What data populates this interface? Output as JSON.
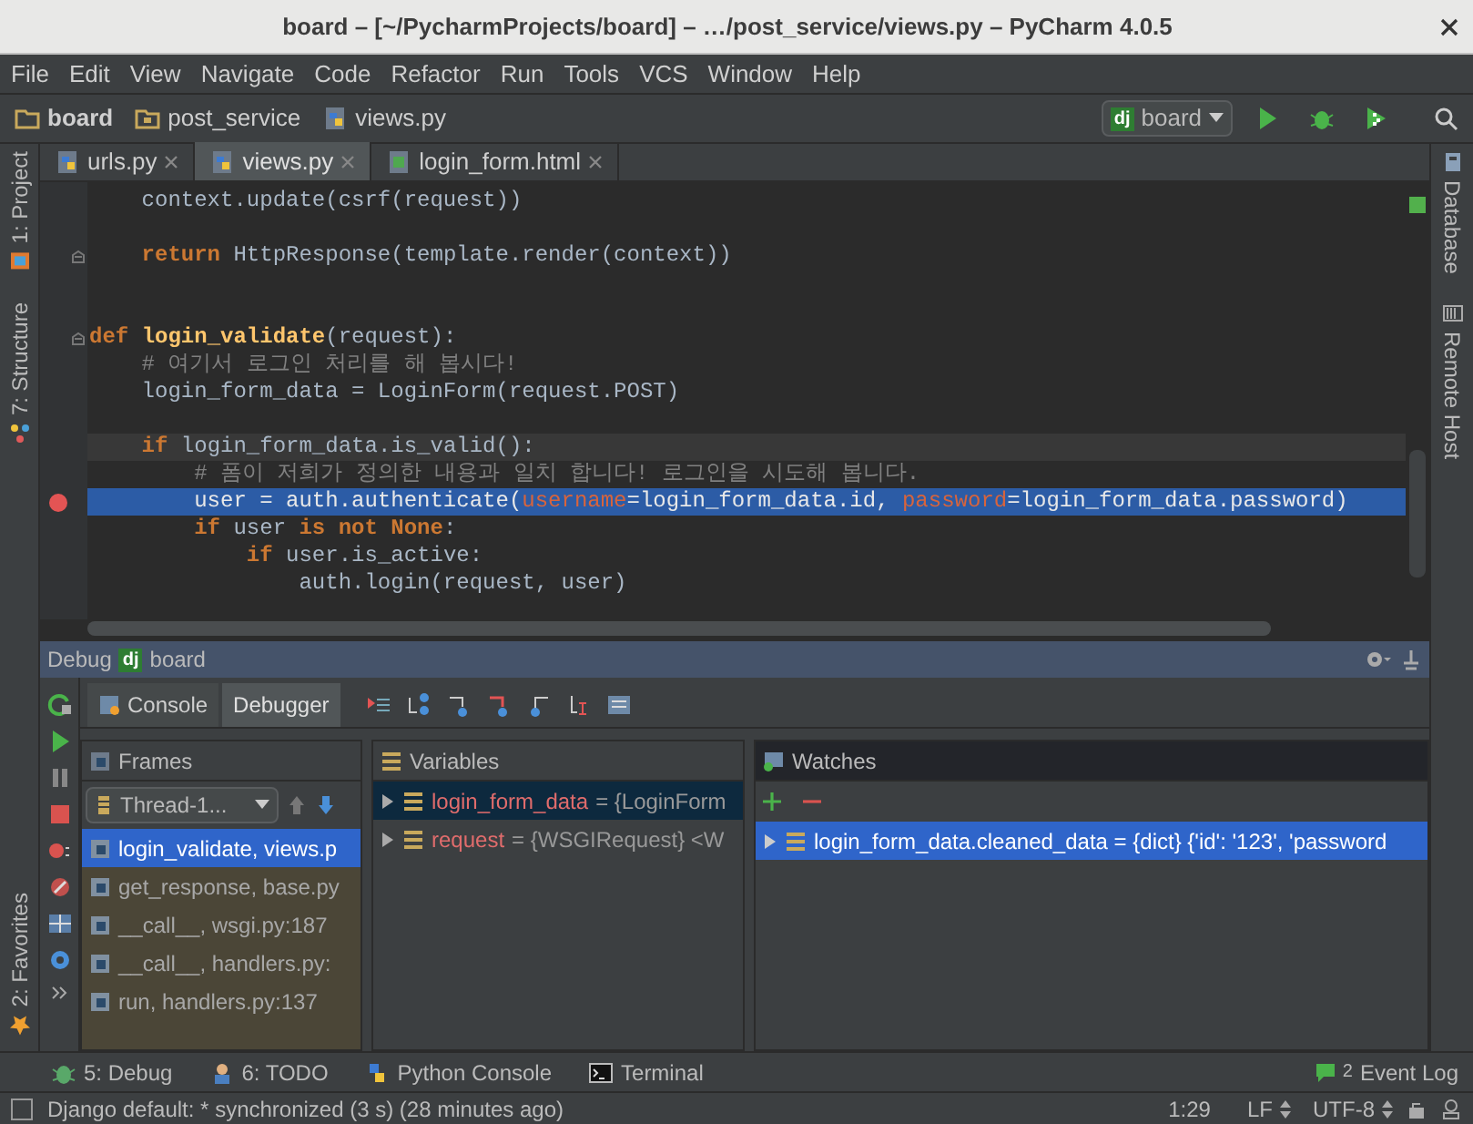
{
  "window": {
    "title": "board – [~/PycharmProjects/board] – …/post_service/views.py – PyCharm 4.0.5"
  },
  "menu": [
    "File",
    "Edit",
    "View",
    "Navigate",
    "Code",
    "Refactor",
    "Run",
    "Tools",
    "VCS",
    "Window",
    "Help"
  ],
  "breadcrumbs": [
    {
      "label": "board",
      "kind": "folder",
      "bold": true
    },
    {
      "label": "post_service",
      "kind": "package",
      "bold": false
    },
    {
      "label": "views.py",
      "kind": "python",
      "bold": false
    }
  ],
  "run_config": {
    "badge": "dj",
    "label": "board"
  },
  "left_tools": [
    {
      "label": "1: Project",
      "kind": "project"
    },
    {
      "label": "7: Structure",
      "kind": "structure"
    }
  ],
  "left_bottom_tools": [
    {
      "label": "2: Favorites",
      "kind": "favorites"
    }
  ],
  "right_tools": [
    {
      "label": "Database",
      "kind": "database"
    },
    {
      "label": "Remote Host",
      "kind": "remote"
    }
  ],
  "editor_tabs": [
    {
      "label": "urls.py",
      "kind": "python",
      "selected": false
    },
    {
      "label": "views.py",
      "kind": "python",
      "selected": true
    },
    {
      "label": "login_form.html",
      "kind": "html",
      "selected": false
    }
  ],
  "code_lines": [
    {
      "kind": "code",
      "fold": false,
      "caret": false,
      "current": false,
      "breakpoint": false,
      "tokens": [
        {
          "kind": "plain",
          "text": "    context.update(csrf(request))"
        }
      ]
    },
    {
      "kind": "blank",
      "fold": false,
      "caret": false,
      "current": false,
      "breakpoint": false
    },
    {
      "kind": "code",
      "fold": true,
      "caret": false,
      "current": false,
      "breakpoint": false,
      "tokens": [
        {
          "kind": "kw",
          "text": "    return "
        },
        {
          "kind": "plain",
          "text": "HttpResponse(template.render(context))"
        }
      ]
    },
    {
      "kind": "blank",
      "fold": false,
      "caret": false,
      "current": false,
      "breakpoint": false
    },
    {
      "kind": "blank",
      "fold": false,
      "caret": false,
      "current": false,
      "breakpoint": false
    },
    {
      "kind": "code",
      "fold": true,
      "caret": false,
      "current": false,
      "breakpoint": false,
      "tokens": [
        {
          "kind": "kw",
          "text": "def "
        },
        {
          "kind": "fn",
          "text": "login_validate"
        },
        {
          "kind": "plain",
          "text": "(request):"
        }
      ]
    },
    {
      "kind": "code",
      "fold": false,
      "caret": false,
      "current": false,
      "breakpoint": false,
      "tokens": [
        {
          "kind": "comment",
          "text": "    # 여기서 로그인 처리를 해 봅시다!"
        }
      ]
    },
    {
      "kind": "code",
      "fold": false,
      "caret": false,
      "current": false,
      "breakpoint": false,
      "tokens": [
        {
          "kind": "plain",
          "text": "    login_form_data = LoginForm(request.POST)"
        }
      ]
    },
    {
      "kind": "blank",
      "fold": false,
      "caret": false,
      "current": false,
      "breakpoint": false
    },
    {
      "kind": "code",
      "fold": false,
      "caret": true,
      "current": false,
      "breakpoint": false,
      "tokens": [
        {
          "kind": "kw",
          "text": "    if "
        },
        {
          "kind": "plain",
          "text": "login_form_data.is_valid():"
        }
      ]
    },
    {
      "kind": "code",
      "fold": false,
      "caret": false,
      "current": false,
      "breakpoint": false,
      "tokens": [
        {
          "kind": "comment",
          "text": "        # 폼이 저희가 정의한 내용과 일치 합니다! 로그인을 시도해 봅니다."
        }
      ]
    },
    {
      "kind": "code",
      "fold": false,
      "caret": false,
      "current": true,
      "breakpoint": true,
      "tokens": [
        {
          "kind": "plain",
          "text": "        user = auth.authenticate("
        },
        {
          "kind": "param",
          "text": "username"
        },
        {
          "kind": "plain",
          "text": "=login_form_data.id, "
        },
        {
          "kind": "param",
          "text": "password"
        },
        {
          "kind": "plain",
          "text": "=login_form_data.password)"
        }
      ]
    },
    {
      "kind": "code",
      "fold": false,
      "caret": false,
      "current": false,
      "breakpoint": false,
      "tokens": [
        {
          "kind": "kw",
          "text": "        if "
        },
        {
          "kind": "plain",
          "text": "user "
        },
        {
          "kind": "kw",
          "text": "is not None"
        },
        {
          "kind": "plain",
          "text": ":"
        }
      ]
    },
    {
      "kind": "code",
      "fold": false,
      "caret": false,
      "current": false,
      "breakpoint": false,
      "tokens": [
        {
          "kind": "kw",
          "text": "            if "
        },
        {
          "kind": "plain",
          "text": "user.is_active:"
        }
      ]
    },
    {
      "kind": "code",
      "fold": false,
      "caret": false,
      "current": false,
      "breakpoint": false,
      "tokens": [
        {
          "kind": "plain",
          "text": "                auth.login(request, user)"
        }
      ]
    }
  ],
  "debug": {
    "title": "Debug",
    "badge": "dj",
    "config": "board",
    "tabs": [
      {
        "label": "Console",
        "selected": false
      },
      {
        "label": "Debugger",
        "selected": true
      }
    ],
    "frames": {
      "title": "Frames",
      "thread": "Thread-1...",
      "items": [
        {
          "label": "login_validate, views.p",
          "selected": true
        },
        {
          "label": "get_response, base.py",
          "selected": false
        },
        {
          "label": "__call__, wsgi.py:187",
          "selected": false
        },
        {
          "label": "__call__, handlers.py:",
          "selected": false
        },
        {
          "label": "run, handlers.py:137",
          "selected": false
        }
      ]
    },
    "variables": {
      "title": "Variables",
      "items": [
        {
          "name": "login_form_data",
          "value": "= {LoginForm",
          "selected": true
        },
        {
          "name": "request",
          "value": "= {WSGIRequest} <W",
          "selected": false
        }
      ]
    },
    "watches": {
      "title": "Watches",
      "items": [
        {
          "text": "login_form_data.cleaned_data = {dict} {'id': '123', 'password",
          "selected": true
        }
      ]
    }
  },
  "tool_windows": [
    {
      "label": "5: Debug",
      "kind": "debug"
    },
    {
      "label": "6: TODO",
      "kind": "todo"
    },
    {
      "label": "Python Console",
      "kind": "python"
    },
    {
      "label": "Terminal",
      "kind": "terminal"
    }
  ],
  "event_log": {
    "count": "2",
    "label": "Event Log"
  },
  "status_bar": {
    "message": "Django default: * synchronized (3 s) (28 minutes ago)",
    "position": "1:29",
    "line_separator": "LF",
    "encoding": "UTF-8"
  }
}
